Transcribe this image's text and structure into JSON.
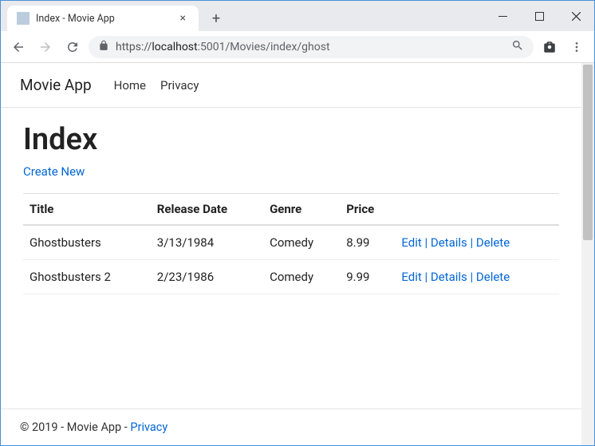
{
  "browser": {
    "tab_title": "Index - Movie App",
    "url_scheme": "https://",
    "url_host": "localhost",
    "url_port": ":5001",
    "url_path": "/Movies/index/ghost"
  },
  "nav": {
    "brand": "Movie App",
    "links": [
      "Home",
      "Privacy"
    ]
  },
  "page": {
    "heading": "Index",
    "create_label": "Create New",
    "columns": [
      "Title",
      "Release Date",
      "Genre",
      "Price"
    ],
    "rows": [
      {
        "title": "Ghostbusters",
        "release": "3/13/1984",
        "genre": "Comedy",
        "price": "8.99"
      },
      {
        "title": "Ghostbusters 2",
        "release": "2/23/1986",
        "genre": "Comedy",
        "price": "9.99"
      }
    ],
    "actions": {
      "edit": "Edit",
      "details": "Details",
      "delete": "Delete"
    }
  },
  "footer": {
    "text": "© 2019 - Movie App - ",
    "privacy": "Privacy"
  }
}
